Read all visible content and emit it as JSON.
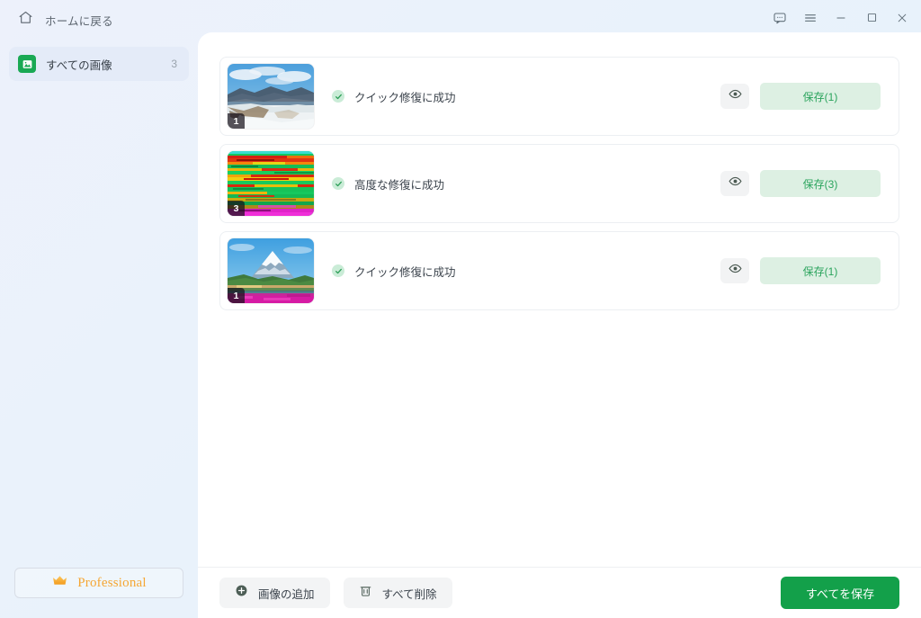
{
  "titlebar": {
    "home_label": "ホームに戻る",
    "home_icon": "home-icon",
    "controls": [
      {
        "name": "feedback-icon",
        "label": ""
      },
      {
        "name": "menu-icon",
        "label": ""
      },
      {
        "name": "minimize-icon",
        "label": ""
      },
      {
        "name": "maximize-icon",
        "label": ""
      },
      {
        "name": "close-icon",
        "label": ""
      }
    ]
  },
  "sidebar": {
    "items": [
      {
        "label": "すべての画像",
        "count": "3",
        "icon": "image-icon",
        "active": true
      }
    ],
    "pro_label": "Professional",
    "pro_icon": "crown-icon"
  },
  "main": {
    "rows": [
      {
        "badge": "1",
        "status_text": "クイック修復に成功",
        "status_icon": "check-circle-icon",
        "preview_icon": "eye-icon",
        "save_label": "保存(1)",
        "thumb": "snow-mountain"
      },
      {
        "badge": "3",
        "status_text": "高度な修復に成功",
        "status_icon": "check-circle-icon",
        "preview_icon": "eye-icon",
        "save_label": "保存(3)",
        "thumb": "corrupted-glitch"
      },
      {
        "badge": "1",
        "status_text": "クイック修復に成功",
        "status_icon": "check-circle-icon",
        "preview_icon": "eye-icon",
        "save_label": "保存(1)",
        "thumb": "fuji-flowers"
      }
    ]
  },
  "footer": {
    "add_label": "画像の追加",
    "add_icon": "plus-circle-icon",
    "delete_label": "すべて削除",
    "delete_icon": "trash-icon",
    "save_all_label": "すべてを保存"
  },
  "colors": {
    "accent_green": "#13a04a",
    "save_bg": "#ddf0e3",
    "save_text": "#2ba45d",
    "pro_orange": "#f5a633",
    "sidebar_bg": "#e9f1fb"
  }
}
